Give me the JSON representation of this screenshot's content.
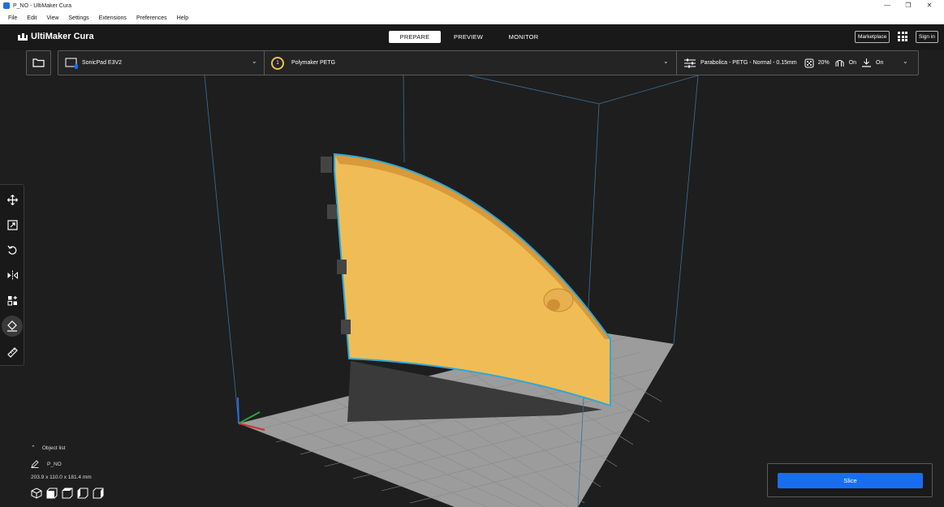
{
  "window": {
    "title": "P_NO - UltiMaker Cura",
    "controls": [
      "—",
      "❐",
      "✕"
    ]
  },
  "menu": [
    "File",
    "Edit",
    "View",
    "Settings",
    "Extensions",
    "Preferences",
    "Help"
  ],
  "header": {
    "logo_text": "UltiMaker Cura",
    "stages": [
      "PREPARE",
      "PREVIEW",
      "MONITOR"
    ],
    "active_stage": "PREPARE",
    "marketplace_label": "Marketplace",
    "signin_label": "Sign in"
  },
  "printer_bar": {
    "printer_name": "SonicPad E3V2",
    "extruder_number": "1",
    "material_name": "Polymaker PETG",
    "profile": "Parabolica - PETG - Normal - 0.15mm",
    "infill": "20%",
    "support": "On",
    "adhesion": "On"
  },
  "object_list": {
    "header": "Object list",
    "object_name": "P_NO",
    "dimensions": "203.9 x 110.0 x 181.4 mm"
  },
  "slice": {
    "button_label": "Slice"
  },
  "colors": {
    "accent": "#196ef0",
    "model": "#f6c15a",
    "outline": "#2fa8d8",
    "build_plate": "#9a9a9a",
    "background": "#1e1e1e"
  },
  "icons": {
    "tools": [
      "move-icon",
      "scale-icon",
      "rotate-icon",
      "mirror-icon",
      "per-model-settings-icon",
      "support-blocker-icon",
      "measure-icon"
    ],
    "view_buttons": [
      "3d-view-icon",
      "front-view-icon",
      "top-view-icon",
      "left-view-icon",
      "right-view-icon"
    ]
  }
}
